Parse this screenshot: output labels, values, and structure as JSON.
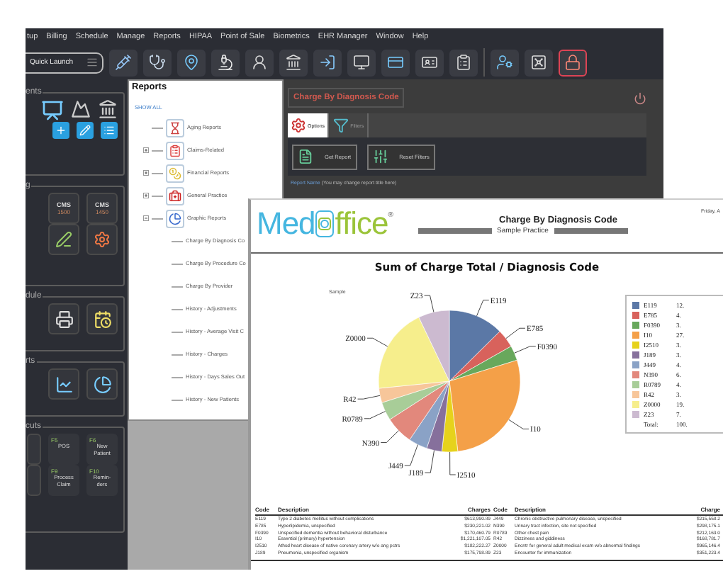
{
  "menu": [
    "tup",
    "Billing",
    "Schedule",
    "Manage",
    "Reports",
    "HIPAA",
    "Point of Sale",
    "Biometrics",
    "EHR Manager",
    "Window",
    "Help"
  ],
  "toolbar": {
    "quick_launch": "Quick Launch"
  },
  "sidebar": {
    "sections": [
      {
        "title": "ents",
        "kind": "appointments"
      },
      {
        "title": "g",
        "kind": "billing",
        "tiles": [
          {
            "line1": "CMS",
            "line2": "1500"
          },
          {
            "line1": "CMS",
            "line2": "1450"
          }
        ]
      },
      {
        "title": "dule",
        "kind": "schedule"
      },
      {
        "title": "rts",
        "kind": "reports"
      },
      {
        "title": "cuts",
        "kind": "shortcuts",
        "shortcuts": [
          {
            "key": "F5",
            "label": "POS"
          },
          {
            "key": "F6",
            "label": "New Patient"
          },
          {
            "key": "F9",
            "label": "Process Claim"
          },
          {
            "key": "F10",
            "label": "Remin- ders"
          }
        ]
      }
    ]
  },
  "reports_tree": {
    "title": "Reports",
    "show_all": "SHOW ALL",
    "items": [
      {
        "label": "Aging Reports",
        "kind": "report"
      },
      {
        "label": "Claims-Related",
        "kind": "folder",
        "expanded": false
      },
      {
        "label": "Financial Reports",
        "kind": "folder",
        "expanded": false
      },
      {
        "label": "General Practice",
        "kind": "folder",
        "expanded": false
      },
      {
        "label": "Graphic Reports",
        "kind": "folder",
        "expanded": true,
        "children": [
          {
            "label": "Charge By Diagnosis Co"
          },
          {
            "label": "Charge By Procedure Co"
          },
          {
            "label": "Charge By Provider"
          },
          {
            "label": "History - Adjustments"
          },
          {
            "label": "History - Average Visit C"
          },
          {
            "label": "History - Charges"
          },
          {
            "label": "History - Days Sales Out"
          },
          {
            "label": "History - New Patients"
          }
        ]
      }
    ]
  },
  "report_panel": {
    "title": "Charge By Diagnosis Code",
    "tabs": [
      {
        "label": "Options",
        "selected": true
      },
      {
        "label": "Filters",
        "selected": false
      }
    ],
    "buttons": [
      "Get Report",
      "Reset Filters"
    ],
    "report_name_label": "Report Name",
    "report_name_hint": "(You may change report title here)"
  },
  "report": {
    "logo_left": "Med",
    "logo_right": "ffice",
    "logo_mark": "®",
    "title": "Charge By Diagnosis Code",
    "subtitle": "Sample Practice",
    "date": "Friday, A",
    "chart_title": "Sum of Charge Total / Diagnosis Code",
    "chart_note": "Sample",
    "chart_data": {
      "type": "pie",
      "categories": [
        "E119",
        "E785",
        "F0390",
        "I10",
        "I2510",
        "J189",
        "J449",
        "N390",
        "R0789",
        "R42",
        "Z0000",
        "Z23"
      ],
      "values": [
        12.6,
        4.2,
        3.4,
        27.9,
        3.6,
        3.5,
        4.3,
        6.4,
        4.2,
        3.3,
        19.5,
        7.1
      ]
    },
    "legend": [
      {
        "code": "E119",
        "value": "12.",
        "color": "#5b78a6"
      },
      {
        "code": "E785",
        "value": "4.",
        "color": "#d8625c"
      },
      {
        "code": "F0390",
        "value": "3.",
        "color": "#68a85c"
      },
      {
        "code": "I10",
        "value": "27.",
        "color": "#f4a048"
      },
      {
        "code": "I2510",
        "value": "3.",
        "color": "#e6d21c"
      },
      {
        "code": "J189",
        "value": "3.",
        "color": "#86709c"
      },
      {
        "code": "J449",
        "value": "4.",
        "color": "#8aa2c6"
      },
      {
        "code": "N390",
        "value": "6.",
        "color": "#e2887c"
      },
      {
        "code": "R0789",
        "value": "4.",
        "color": "#a8cd98"
      },
      {
        "code": "R42",
        "value": "3.",
        "color": "#f7c69a"
      },
      {
        "code": "Z0000",
        "value": "19.",
        "color": "#f6ee8c"
      },
      {
        "code": "Z23",
        "value": "7.",
        "color": "#ccbad0"
      }
    ],
    "legend_total": {
      "label": "Total:",
      "value": "100."
    },
    "table": {
      "columns": [
        "Code",
        "Description",
        "Charges",
        "Code",
        "Description",
        "Charge"
      ],
      "rows": [
        [
          "E119",
          "Type 2 diabetes mellitus without complications",
          "$613,990.89",
          "J449",
          "Chronic obstructive pulmonary disease, unspecified",
          "$215,558.2"
        ],
        [
          "E785",
          "Hyperlipidemia, unspecified",
          "$230,221.02",
          "N390",
          "Urinary tract infection, site not specified",
          "$298,175.1"
        ],
        [
          "F0390",
          "Unspecified dementia without behavioral disturbance",
          "$170,460.79",
          "R0789",
          "Other chest pain",
          "$212,163.0"
        ],
        [
          "I10",
          "Essential (primary) hypertension",
          "$1,221,107.05",
          "R42",
          "Dizziness and giddiness",
          "$168,781.7"
        ],
        [
          "I2510",
          "Athsd heart disease of native coronary artery w/o ang pctrs",
          "$182,222.27",
          "Z0000",
          "Encntr for general adult medical exam w/o abnormal findings",
          "$965,146.4"
        ],
        [
          "J189",
          "Pneumonia, unspecified organism",
          "$175,798.89",
          "Z23",
          "Encounter for immunization",
          "$351,223.4"
        ]
      ]
    }
  }
}
